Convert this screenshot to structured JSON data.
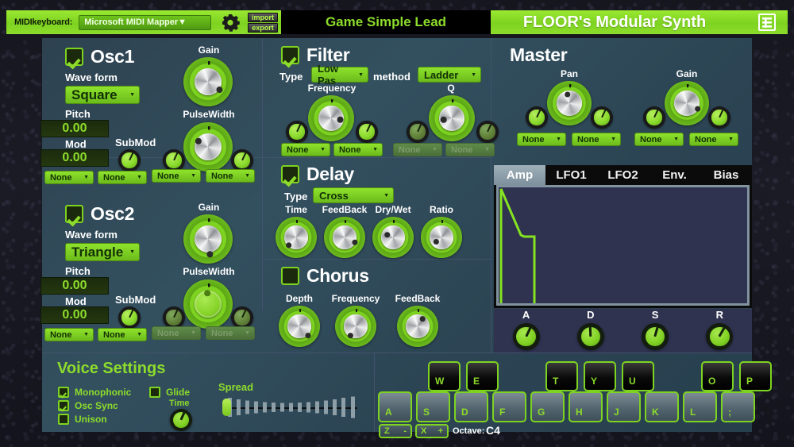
{
  "topbar": {
    "midi_label": "MIDIkeyboard:",
    "midi_device": "Microsoft MIDI Mapper",
    "gear_icon": "gear-icon",
    "import_label": "import",
    "export_label": "export",
    "preset_name": "Game Simple Lead",
    "app_title": "FLOOR's Modular Synth",
    "logo_icon": "menu-logo-icon",
    "accent": "#8ddc2b",
    "bar_green": "#7ed321"
  },
  "osc1": {
    "title": "Osc1",
    "enabled": true,
    "waveform_label": "Wave form",
    "waveform_value": "Square",
    "pitch_label": "Pitch",
    "pitch_value": "0.00",
    "mod_label": "Mod",
    "mod_value": "0.00",
    "submod_label": "SubMod",
    "gain_label": "Gain",
    "pulsewidth_label": "PulseWidth",
    "mod_sources": [
      "None",
      "None",
      "None",
      "None"
    ],
    "pw_knob_disabled": false
  },
  "osc2": {
    "title": "Osc2",
    "enabled": true,
    "waveform_label": "Wave form",
    "waveform_value": "Triangle",
    "pitch_label": "Pitch",
    "pitch_value": "0.00",
    "mod_label": "Mod",
    "mod_value": "0.00",
    "submod_label": "SubMod",
    "gain_label": "Gain",
    "pulsewidth_label": "PulseWidth",
    "mod_sources": [
      "None",
      "None",
      "None",
      "None"
    ],
    "pw_knob_disabled": true
  },
  "filter": {
    "title": "Filter",
    "enabled": true,
    "type_label": "Type",
    "type_value": "Low Pas",
    "method_label": "method",
    "method_value": "Ladder",
    "frequency_label": "Frequency",
    "q_label": "Q",
    "mod_sources": [
      "None",
      "None",
      "None",
      "None"
    ]
  },
  "delay": {
    "title": "Delay",
    "enabled": true,
    "type_label": "Type",
    "type_value": "Cross",
    "knobs": [
      "Time",
      "FeedBack",
      "Dry/Wet",
      "Ratio"
    ]
  },
  "chorus": {
    "title": "Chorus",
    "enabled": false,
    "knobs": [
      "Depth",
      "Frequency",
      "FeedBack"
    ]
  },
  "master": {
    "title": "Master",
    "pan_label": "Pan",
    "gain_label": "Gain",
    "mod_sources": [
      "None",
      "None",
      "None",
      "None"
    ]
  },
  "envelope": {
    "tabs": [
      "Amp",
      "LFO1",
      "LFO2",
      "Env.",
      "Bias"
    ],
    "active_tab": "Amp",
    "adsr_labels": [
      "A",
      "D",
      "S",
      "R"
    ],
    "curve_color": "#86e321"
  },
  "voice": {
    "title": "Voice Settings",
    "monophonic_label": "Monophonic",
    "monophonic": true,
    "oscsync_label": "Osc Sync",
    "oscsync": true,
    "unison_label": "Unison",
    "unison": false,
    "glide_label": "Glide",
    "glide": false,
    "time_label": "Time",
    "spread_label": "Spread"
  },
  "keyboard": {
    "black_keys": [
      "W",
      "E",
      "T",
      "Y",
      "U",
      "O",
      "P"
    ],
    "white_keys": [
      "A",
      "S",
      "D",
      "F",
      "G",
      "H",
      "J",
      "K",
      "L",
      ";"
    ],
    "octave_down_key": "Z",
    "octave_down_sign": "-",
    "octave_up_key": "X",
    "octave_up_sign": "+",
    "octave_label": "Octave:",
    "octave_value": "C4"
  }
}
